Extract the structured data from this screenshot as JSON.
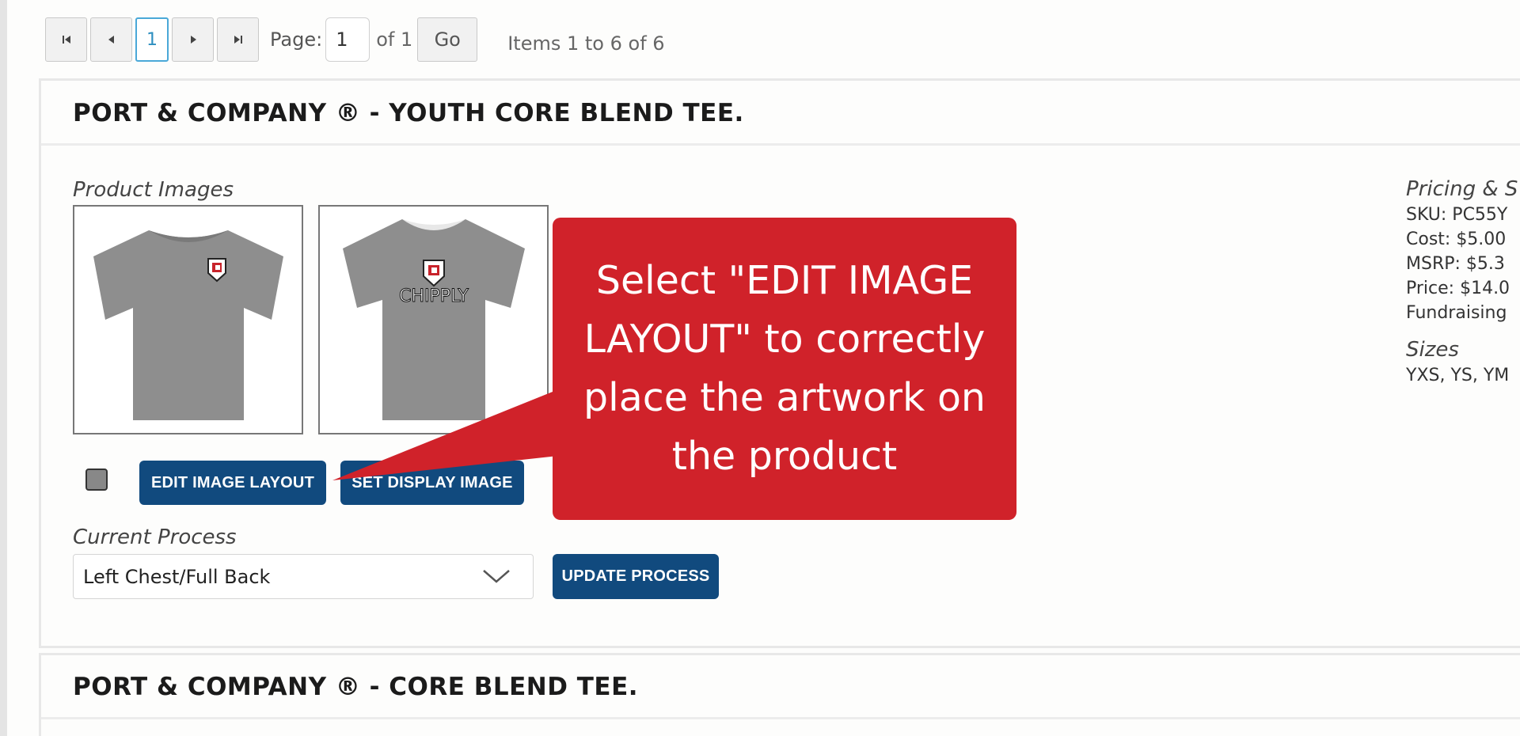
{
  "pager": {
    "current_page": "1",
    "page_label": "Page:",
    "page_input_value": "1",
    "of_label": "of 1",
    "go_label": "Go",
    "items_info": "Items 1 to 6 of 6"
  },
  "product1": {
    "title": "PORT & COMPANY ® - YOUTH CORE BLEND TEE.",
    "images_label": "Product Images",
    "thumb1_logo_text": "CHIPPLY",
    "edit_image_layout": "EDIT IMAGE LAYOUT",
    "set_display_image": "SET DISPLAY IMAGE",
    "current_process_label": "Current Process",
    "process_value": "Left Chest/Full Back",
    "update_process": "UPDATE PROCESS",
    "pricing": {
      "heading": "Pricing & S",
      "sku": "SKU: PC55Y",
      "cost": "Cost: $5.00",
      "msrp": "MSRP: $5.3",
      "price": "Price: $14.0",
      "fundraising": "Fundraising"
    },
    "sizes_label": "Sizes",
    "sizes_value": "YXS, YS, YM"
  },
  "product2": {
    "title": "PORT & COMPANY ® - CORE BLEND TEE."
  },
  "callout": {
    "text": "Select \"EDIT IMAGE LAYOUT\" to correctly place the artwork on the product",
    "color": "#d0222a"
  },
  "colors": {
    "primary_button": "#114a7e",
    "shirt": "#8e8e8e"
  }
}
